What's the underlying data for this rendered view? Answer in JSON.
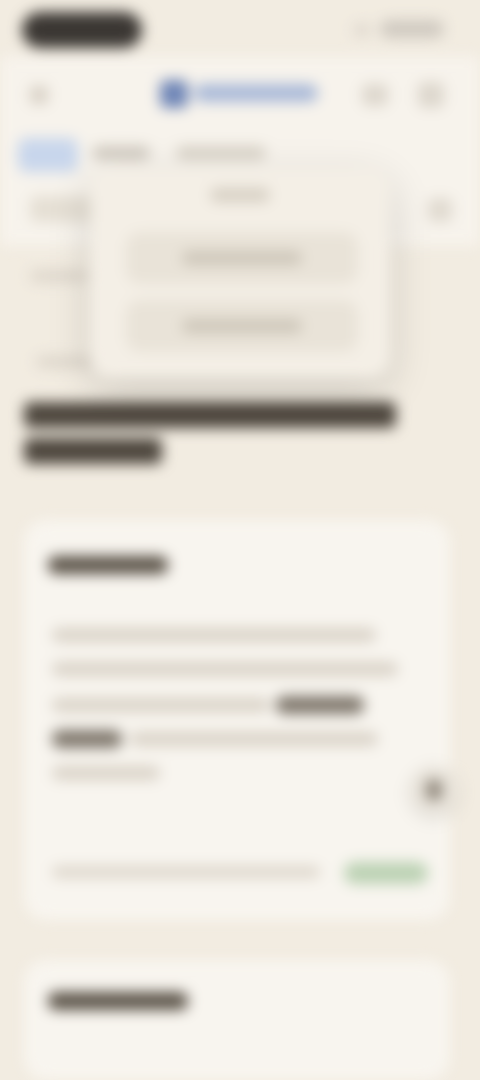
{
  "status_bar": {},
  "top_nav": {
    "logo_text": "",
    "tabs": [
      {
        "label": ""
      },
      {
        "label": ""
      },
      {
        "label": ""
      }
    ]
  },
  "popover": {
    "title": "",
    "options": [
      {
        "label": ""
      },
      {
        "label": ""
      }
    ]
  },
  "breadcrumb": {
    "first": "",
    "second": ""
  },
  "main": {
    "heading": ""
  },
  "card": {
    "title": "",
    "body": "",
    "footer_text": "",
    "badge": ""
  },
  "card2": {
    "title": ""
  },
  "colors": {
    "background": "#f2ece1",
    "accent": "#6f86b7",
    "card": "#f8f5ef",
    "badge": "#bcd2b4"
  },
  "icons": [
    "back-icon",
    "logo-icon",
    "search-icon",
    "menu-icon",
    "action-icon"
  ]
}
